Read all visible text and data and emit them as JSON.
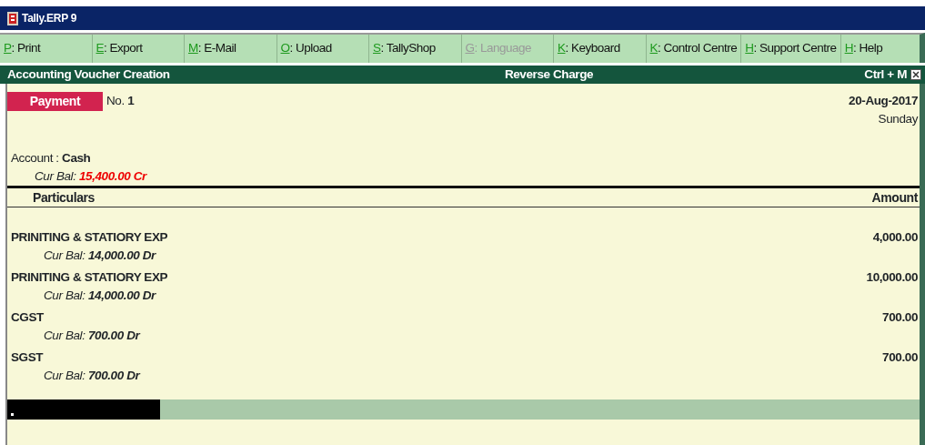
{
  "window": {
    "title": "Tally.ERP 9"
  },
  "menu": [
    {
      "key": "P",
      "label": ": Print",
      "disabled": false
    },
    {
      "key": "E",
      "label": ": Export",
      "disabled": false
    },
    {
      "key": "M",
      "label": ": E-Mail",
      "disabled": false
    },
    {
      "key": "O",
      "label": ": Upload",
      "disabled": false
    },
    {
      "key": "S",
      "label": ": TallyShop",
      "disabled": false
    },
    {
      "key": "G",
      "label": ": Language",
      "disabled": true
    },
    {
      "key": "K",
      "label": ": Keyboard",
      "disabled": false
    },
    {
      "key": "K",
      "label": ": Control Centre",
      "disabled": false
    },
    {
      "key": "H",
      "label": ": Support Centre",
      "disabled": false
    },
    {
      "key": "H",
      "label": ": Help",
      "disabled": false
    }
  ],
  "header": {
    "title": "Accounting Voucher  Creation",
    "center": "Reverse Charge",
    "shortcut": "Ctrl + M"
  },
  "voucher": {
    "type": "Payment",
    "number_label": "No.",
    "number": "1",
    "date": "20-Aug-2017",
    "day": "Sunday"
  },
  "account": {
    "label": "Account :",
    "name": "Cash",
    "bal_label": "Cur Bal:",
    "balance": "15,400.00 Cr"
  },
  "table": {
    "columns": [
      "Particulars",
      "Amount"
    ],
    "rows": [
      {
        "name": "PRINITING & STATIORY EXP",
        "bal_label": "Cur Bal:",
        "balance": "14,000.00 Dr",
        "amount": "4,000.00"
      },
      {
        "name": "PRINITING & STATIORY EXP",
        "bal_label": "Cur Bal:",
        "balance": "14,000.00 Dr",
        "amount": "10,000.00"
      },
      {
        "name": "CGST",
        "bal_label": "Cur Bal:",
        "balance": "700.00 Dr",
        "amount": "700.00"
      },
      {
        "name": "SGST",
        "bal_label": "Cur Bal:",
        "balance": "700.00 Dr",
        "amount": "700.00"
      }
    ]
  }
}
